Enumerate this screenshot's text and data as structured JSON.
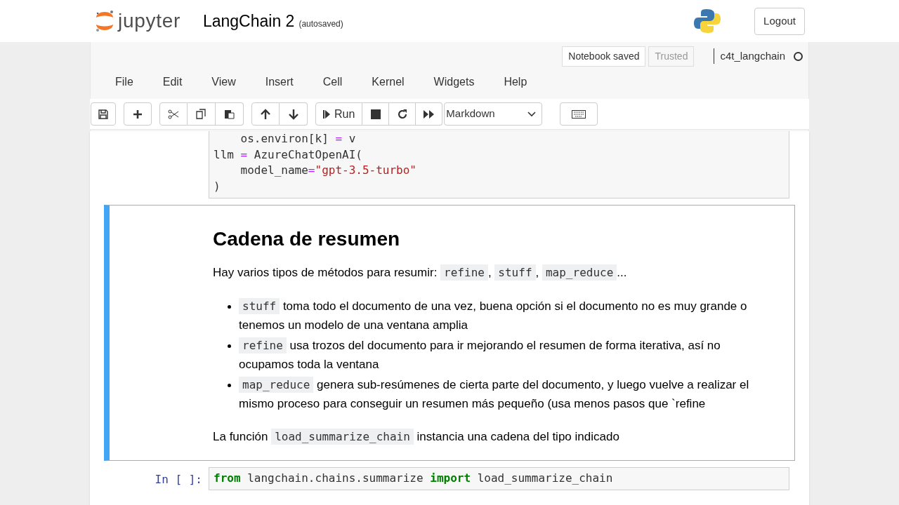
{
  "header": {
    "logo_text": "jupyter",
    "notebook_title": "LangChain 2",
    "autosave_status": "(autosaved)",
    "logout": "Logout"
  },
  "status": {
    "notebook_saved": "Notebook saved",
    "trusted": "Trusted",
    "kernel_name": "c4t_langchain",
    "kernel_busy": false
  },
  "menu": [
    "File",
    "Edit",
    "View",
    "Insert",
    "Cell",
    "Kernel",
    "Widgets",
    "Help"
  ],
  "toolbar": {
    "run_label": "Run",
    "cell_type": "Markdown"
  },
  "cells": [
    {
      "kind": "code",
      "lines": [
        [
          {
            "t": "    os.environ[k] ",
            "kind": "plain"
          },
          {
            "t": "=",
            "kind": "op"
          },
          {
            "t": " v",
            "kind": "plain"
          }
        ],
        [
          {
            "t": "llm ",
            "kind": "plain"
          },
          {
            "t": "=",
            "kind": "op"
          },
          {
            "t": " AzureChatOpenAI(",
            "kind": "plain"
          }
        ],
        [
          {
            "t": "    model_name",
            "kind": "plain"
          },
          {
            "t": "=",
            "kind": "op"
          },
          {
            "t": "\"gpt-3.5-turbo\"",
            "kind": "string"
          }
        ],
        [
          {
            "t": ")",
            "kind": "plain"
          }
        ]
      ]
    },
    {
      "kind": "markdown",
      "selected": true,
      "heading": "Cadena de resumen",
      "blocks": [
        {
          "kind": "paragraph",
          "segments": [
            {
              "kind": "text",
              "t": "Hay varios tipos de métodos para resumir: "
            },
            {
              "kind": "code",
              "t": "refine"
            },
            {
              "kind": "text",
              "t": ", "
            },
            {
              "kind": "code",
              "t": "stuff"
            },
            {
              "kind": "text",
              "t": ", "
            },
            {
              "kind": "code",
              "t": "map_reduce"
            },
            {
              "kind": "text",
              "t": "..."
            }
          ]
        },
        {
          "kind": "list",
          "items": [
            [
              {
                "kind": "code",
                "t": "stuff"
              },
              {
                "kind": "text",
                "t": " toma todo el documento de una vez, buena opción si el documento no es muy grande o tenemos un modelo de una ventana amplia"
              }
            ],
            [
              {
                "kind": "code",
                "t": "refine"
              },
              {
                "kind": "text",
                "t": " usa trozos del documento para ir mejorando el resumen de forma iterativa, así no ocupamos toda la ventana"
              }
            ],
            [
              {
                "kind": "code",
                "t": "map_reduce"
              },
              {
                "kind": "text",
                "t": " genera sub-resúmenes de cierta parte del documento, y luego vuelve a realizar el mismo proceso para conseguir un resumen más pequeño (usa menos pasos que `refine"
              }
            ]
          ]
        },
        {
          "kind": "paragraph",
          "segments": [
            {
              "kind": "text",
              "t": "La función "
            },
            {
              "kind": "code",
              "t": "load_summarize_chain"
            },
            {
              "kind": "text",
              "t": " instancia una cadena del tipo indicado"
            }
          ]
        }
      ]
    },
    {
      "kind": "code",
      "prompt": "In [ ]:",
      "lines": [
        [
          {
            "t": "from",
            "kind": "keyword"
          },
          {
            "t": " langchain.chains.summarize ",
            "kind": "plain"
          },
          {
            "t": "import",
            "kind": "keyword"
          },
          {
            "t": " load_summarize_chain",
            "kind": "plain"
          }
        ]
      ]
    }
  ]
}
